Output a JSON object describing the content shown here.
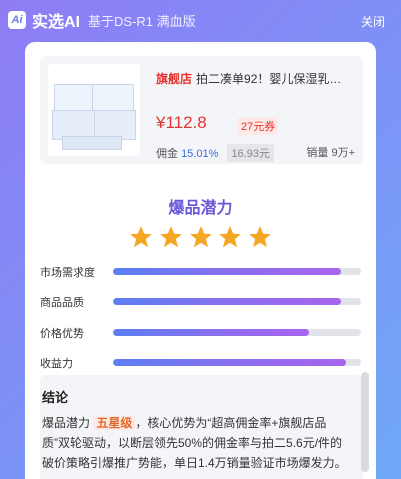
{
  "header": {
    "logo_text": "Ai",
    "title": "实选AI",
    "subtitle": "基于DS-R1 满血版",
    "close_label": "关闭"
  },
  "product": {
    "flag": "旗舰店",
    "title": "拍二凑单92！婴儿保湿乳…",
    "price": "¥112.8",
    "coupon": "27元券",
    "commission_label": "佣金",
    "commission_rate": "15.01%",
    "commission_amount": "16.93元",
    "sales": "销量 9万+"
  },
  "potential": {
    "title": "爆品潜力",
    "stars": 5,
    "star_color": "#f5a623"
  },
  "metrics": [
    {
      "label": "市场需求度",
      "value": 0.92
    },
    {
      "label": "商品品质",
      "value": 0.92
    },
    {
      "label": "价格优势",
      "value": 0.79
    },
    {
      "label": "收益力",
      "value": 0.94
    }
  ],
  "conclusion": {
    "title": "结论",
    "text_before": "爆品潜力 ",
    "badge": "五星级",
    "text_after": "，核心优势为“超高佣金率+旗舰店品质”双轮驱动，以断层领先50%的佣金率与拍二5.6元/件的破价策略引爆推广势能，单日1.4万销量验证市场爆发力。"
  },
  "colors": {
    "accent": "#6a5ad8",
    "price": "#e3342f",
    "link": "#3b6fe0"
  }
}
